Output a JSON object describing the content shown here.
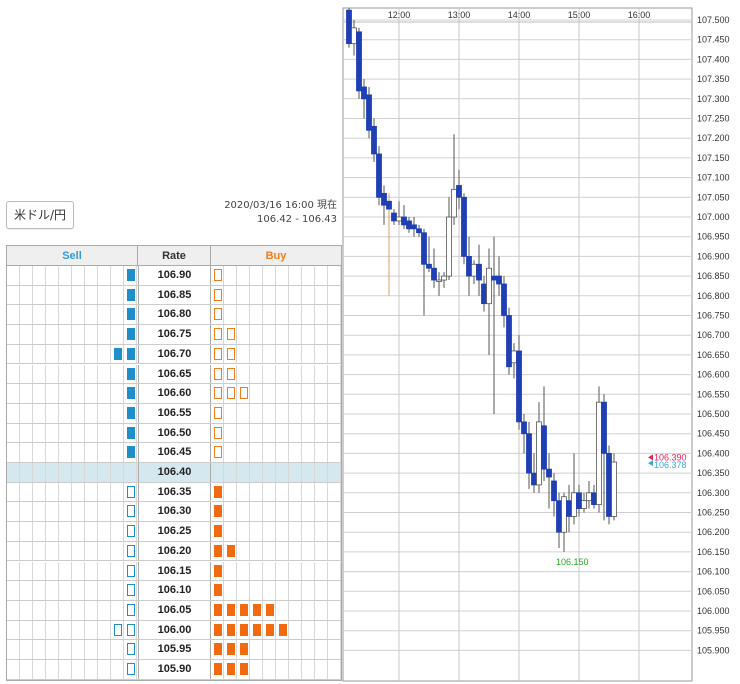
{
  "pair_button": {
    "label": "米ドル/円"
  },
  "timestamp": {
    "line1": "2020/03/16 16:00 現在",
    "line2": "106.42 - 106.43"
  },
  "board": {
    "headers": {
      "sell": "Sell",
      "rate": "Rate",
      "buy": "Buy"
    },
    "current_rate": "106.40",
    "rows": [
      {
        "rate": "106.90",
        "sell_filled": 1,
        "sell_outline": 0,
        "buy_filled": 0,
        "buy_outline": 1
      },
      {
        "rate": "106.85",
        "sell_filled": 1,
        "sell_outline": 0,
        "buy_filled": 0,
        "buy_outline": 1
      },
      {
        "rate": "106.80",
        "sell_filled": 1,
        "sell_outline": 0,
        "buy_filled": 0,
        "buy_outline": 1
      },
      {
        "rate": "106.75",
        "sell_filled": 1,
        "sell_outline": 0,
        "buy_filled": 0,
        "buy_outline": 2
      },
      {
        "rate": "106.70",
        "sell_filled": 2,
        "sell_outline": 0,
        "buy_filled": 0,
        "buy_outline": 2
      },
      {
        "rate": "106.65",
        "sell_filled": 1,
        "sell_outline": 0,
        "buy_filled": 0,
        "buy_outline": 2
      },
      {
        "rate": "106.60",
        "sell_filled": 1,
        "sell_outline": 0,
        "buy_filled": 0,
        "buy_outline": 3
      },
      {
        "rate": "106.55",
        "sell_filled": 1,
        "sell_outline": 0,
        "buy_filled": 0,
        "buy_outline": 1
      },
      {
        "rate": "106.50",
        "sell_filled": 1,
        "sell_outline": 0,
        "buy_filled": 0,
        "buy_outline": 1
      },
      {
        "rate": "106.45",
        "sell_filled": 1,
        "sell_outline": 0,
        "buy_filled": 0,
        "buy_outline": 1
      },
      {
        "rate": "106.40",
        "sell_filled": 0,
        "sell_outline": 0,
        "buy_filled": 0,
        "buy_outline": 0
      },
      {
        "rate": "106.35",
        "sell_filled": 0,
        "sell_outline": 1,
        "buy_filled": 1,
        "buy_outline": 0
      },
      {
        "rate": "106.30",
        "sell_filled": 0,
        "sell_outline": 1,
        "buy_filled": 1,
        "buy_outline": 0
      },
      {
        "rate": "106.25",
        "sell_filled": 0,
        "sell_outline": 1,
        "buy_filled": 1,
        "buy_outline": 0
      },
      {
        "rate": "106.20",
        "sell_filled": 0,
        "sell_outline": 1,
        "buy_filled": 2,
        "buy_outline": 0
      },
      {
        "rate": "106.15",
        "sell_filled": 0,
        "sell_outline": 1,
        "buy_filled": 1,
        "buy_outline": 0
      },
      {
        "rate": "106.10",
        "sell_filled": 0,
        "sell_outline": 1,
        "buy_filled": 1,
        "buy_outline": 0
      },
      {
        "rate": "106.05",
        "sell_filled": 0,
        "sell_outline": 1,
        "buy_filled": 5,
        "buy_outline": 0
      },
      {
        "rate": "106.00",
        "sell_filled": 0,
        "sell_outline": 2,
        "buy_filled": 6,
        "buy_outline": 0
      },
      {
        "rate": "105.95",
        "sell_filled": 0,
        "sell_outline": 1,
        "buy_filled": 3,
        "buy_outline": 0
      },
      {
        "rate": "105.90",
        "sell_filled": 0,
        "sell_outline": 1,
        "buy_filled": 3,
        "buy_outline": 0
      }
    ]
  },
  "colors": {
    "sell": "#1e8fc9",
    "buy": "#f26a0f",
    "candle_down": "#1f3fb5",
    "candle_up": "#ffffff",
    "ask_marker": "#e6245a",
    "bid_marker": "#33aadd",
    "low_label": "#22aa22",
    "grid": "#d0d0d0"
  },
  "chart_data": {
    "type": "candlestick",
    "x_tick_labels": [
      "12:00",
      "13:00",
      "14:00",
      "15:00",
      "16:00"
    ],
    "y_range": [
      105.875,
      107.575
    ],
    "y_tick_labels": [
      "107.500",
      "107.450",
      "107.400",
      "107.350",
      "107.300",
      "107.250",
      "107.200",
      "107.150",
      "107.100",
      "107.050",
      "107.000",
      "106.950",
      "106.900",
      "106.850",
      "106.800",
      "106.750",
      "106.700",
      "106.650",
      "106.600",
      "106.550",
      "106.500",
      "106.450",
      "106.400",
      "106.350",
      "106.300",
      "106.250",
      "106.200",
      "106.150",
      "106.100",
      "106.050",
      "106.000",
      "105.950",
      "105.900"
    ],
    "current_ask": "106.390",
    "current_bid": "106.378",
    "low_annotation": "106.150",
    "candles": [
      {
        "t": "11:10",
        "o": 107.525,
        "h": 107.53,
        "l": 107.43,
        "c": 107.44
      },
      {
        "t": "11:15",
        "o": 107.44,
        "h": 107.5,
        "l": 107.41,
        "c": 107.48
      },
      {
        "t": "11:20",
        "o": 107.47,
        "h": 107.48,
        "l": 107.3,
        "c": 107.32
      },
      {
        "t": "11:25",
        "o": 107.33,
        "h": 107.35,
        "l": 107.25,
        "c": 107.3
      },
      {
        "t": "11:30",
        "o": 107.31,
        "h": 107.33,
        "l": 107.2,
        "c": 107.22
      },
      {
        "t": "11:35",
        "o": 107.23,
        "h": 107.25,
        "l": 107.14,
        "c": 107.16
      },
      {
        "t": "11:40",
        "o": 107.16,
        "h": 107.18,
        "l": 107.03,
        "c": 107.05
      },
      {
        "t": "11:45",
        "o": 107.06,
        "h": 107.08,
        "l": 106.98,
        "c": 107.03
      },
      {
        "t": "11:50",
        "o": 107.04,
        "h": 107.06,
        "l": 106.8,
        "c": 107.02
      },
      {
        "t": "11:55",
        "o": 107.01,
        "h": 107.02,
        "l": 106.98,
        "c": 106.99
      },
      {
        "t": "12:00",
        "o": 106.99,
        "h": 107.04,
        "l": 106.98,
        "c": 107.0
      },
      {
        "t": "12:05",
        "o": 107.0,
        "h": 107.03,
        "l": 106.97,
        "c": 106.98
      },
      {
        "t": "12:10",
        "o": 106.99,
        "h": 107.0,
        "l": 106.96,
        "c": 106.97
      },
      {
        "t": "12:15",
        "o": 106.98,
        "h": 107.0,
        "l": 106.95,
        "c": 106.97
      },
      {
        "t": "12:20",
        "o": 106.97,
        "h": 106.98,
        "l": 106.95,
        "c": 106.96
      },
      {
        "t": "12:25",
        "o": 106.96,
        "h": 106.97,
        "l": 106.75,
        "c": 106.88
      },
      {
        "t": "12:30",
        "o": 106.88,
        "h": 106.95,
        "l": 106.86,
        "c": 106.87
      },
      {
        "t": "12:35",
        "o": 106.87,
        "h": 106.92,
        "l": 106.82,
        "c": 106.84
      },
      {
        "t": "12:40",
        "o": 106.84,
        "h": 106.86,
        "l": 106.8,
        "c": 106.84
      },
      {
        "t": "12:45",
        "o": 106.84,
        "h": 106.86,
        "l": 106.82,
        "c": 106.85
      },
      {
        "t": "12:50",
        "o": 106.85,
        "h": 107.05,
        "l": 106.84,
        "c": 107.0
      },
      {
        "t": "12:55",
        "o": 107.0,
        "h": 107.21,
        "l": 106.98,
        "c": 107.07
      },
      {
        "t": "13:00",
        "o": 107.08,
        "h": 107.12,
        "l": 107.02,
        "c": 107.05
      },
      {
        "t": "13:05",
        "o": 107.05,
        "h": 107.06,
        "l": 106.88,
        "c": 106.9
      },
      {
        "t": "13:10",
        "o": 106.9,
        "h": 106.95,
        "l": 106.8,
        "c": 106.85
      },
      {
        "t": "13:15",
        "o": 106.85,
        "h": 106.89,
        "l": 106.83,
        "c": 106.88
      },
      {
        "t": "13:20",
        "o": 106.88,
        "h": 106.93,
        "l": 106.8,
        "c": 106.84
      },
      {
        "t": "13:25",
        "o": 106.83,
        "h": 106.85,
        "l": 106.76,
        "c": 106.78
      },
      {
        "t": "13:30",
        "o": 106.78,
        "h": 106.92,
        "l": 106.65,
        "c": 106.87
      },
      {
        "t": "13:35",
        "o": 106.85,
        "h": 106.95,
        "l": 106.5,
        "c": 106.84
      },
      {
        "t": "13:40",
        "o": 106.85,
        "h": 106.9,
        "l": 106.8,
        "c": 106.83
      },
      {
        "t": "13:45",
        "o": 106.83,
        "h": 106.85,
        "l": 106.72,
        "c": 106.75
      },
      {
        "t": "13:50",
        "o": 106.75,
        "h": 106.77,
        "l": 106.6,
        "c": 106.62
      },
      {
        "t": "13:55",
        "o": 106.63,
        "h": 106.68,
        "l": 106.59,
        "c": 106.66
      },
      {
        "t": "14:00",
        "o": 106.66,
        "h": 106.7,
        "l": 106.46,
        "c": 106.48
      },
      {
        "t": "14:05",
        "o": 106.48,
        "h": 106.5,
        "l": 106.4,
        "c": 106.45
      },
      {
        "t": "14:10",
        "o": 106.45,
        "h": 106.48,
        "l": 106.31,
        "c": 106.35
      },
      {
        "t": "14:15",
        "o": 106.35,
        "h": 106.4,
        "l": 106.3,
        "c": 106.32
      },
      {
        "t": "14:20",
        "o": 106.32,
        "h": 106.53,
        "l": 106.3,
        "c": 106.48
      },
      {
        "t": "14:25",
        "o": 106.47,
        "h": 106.57,
        "l": 106.33,
        "c": 106.36
      },
      {
        "t": "14:30",
        "o": 106.36,
        "h": 106.4,
        "l": 106.26,
        "c": 106.34
      },
      {
        "t": "14:35",
        "o": 106.33,
        "h": 106.35,
        "l": 106.24,
        "c": 106.28
      },
      {
        "t": "14:40",
        "o": 106.28,
        "h": 106.3,
        "l": 106.16,
        "c": 106.2
      },
      {
        "t": "14:45",
        "o": 106.2,
        "h": 106.3,
        "l": 106.15,
        "c": 106.29
      },
      {
        "t": "14:50",
        "o": 106.28,
        "h": 106.32,
        "l": 106.2,
        "c": 106.24
      },
      {
        "t": "14:55",
        "o": 106.24,
        "h": 106.4,
        "l": 106.22,
        "c": 106.3
      },
      {
        "t": "15:00",
        "o": 106.3,
        "h": 106.32,
        "l": 106.24,
        "c": 106.26
      },
      {
        "t": "15:05",
        "o": 106.26,
        "h": 106.3,
        "l": 106.25,
        "c": 106.28
      },
      {
        "t": "15:10",
        "o": 106.28,
        "h": 106.33,
        "l": 106.26,
        "c": 106.3
      },
      {
        "t": "15:15",
        "o": 106.3,
        "h": 106.32,
        "l": 106.26,
        "c": 106.27
      },
      {
        "t": "15:20",
        "o": 106.27,
        "h": 106.57,
        "l": 106.25,
        "c": 106.53
      },
      {
        "t": "15:25",
        "o": 106.53,
        "h": 106.55,
        "l": 106.23,
        "c": 106.4
      },
      {
        "t": "15:30",
        "o": 106.4,
        "h": 106.42,
        "l": 106.22,
        "c": 106.24
      },
      {
        "t": "15:35",
        "o": 106.24,
        "h": 106.4,
        "l": 106.23,
        "c": 106.378
      }
    ]
  }
}
